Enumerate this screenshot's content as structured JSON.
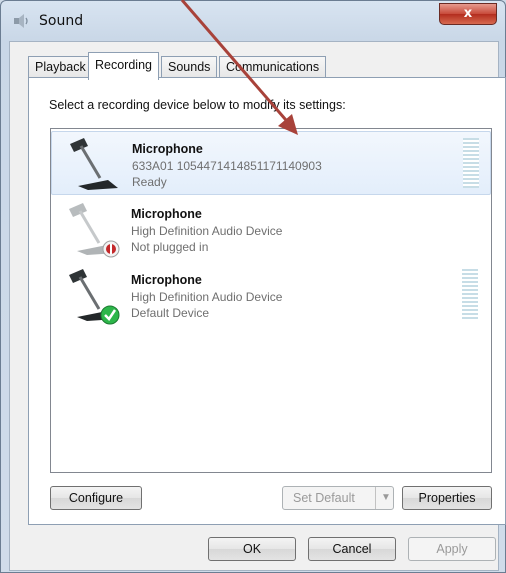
{
  "window": {
    "title": "Sound",
    "close_label": "x"
  },
  "tabs": [
    {
      "label": "Playback"
    },
    {
      "label": "Recording"
    },
    {
      "label": "Sounds"
    },
    {
      "label": "Communications"
    }
  ],
  "panel": {
    "instruction": "Select a recording device below to modify its settings:"
  },
  "devices": [
    {
      "name": "Microphone",
      "detail": "633A01     1054471414851171140903",
      "status": "Ready",
      "selected": true,
      "icon": "microphone-icon"
    },
    {
      "name": "Microphone",
      "detail": "High Definition Audio Device",
      "status": "Not plugged in",
      "selected": false,
      "icon": "microphone-unplugged-icon"
    },
    {
      "name": "Microphone",
      "detail": "High Definition Audio Device",
      "status": "Default Device",
      "selected": false,
      "icon": "microphone-default-icon"
    }
  ],
  "buttons": {
    "configure": "Configure",
    "set_default": "Set Default",
    "properties": "Properties",
    "ok": "OK",
    "cancel": "Cancel",
    "apply": "Apply"
  },
  "colors": {
    "annotation_arrow": "#a8423a",
    "default_badge": "#2db64a",
    "unplugged_badge": "#c4282a"
  }
}
